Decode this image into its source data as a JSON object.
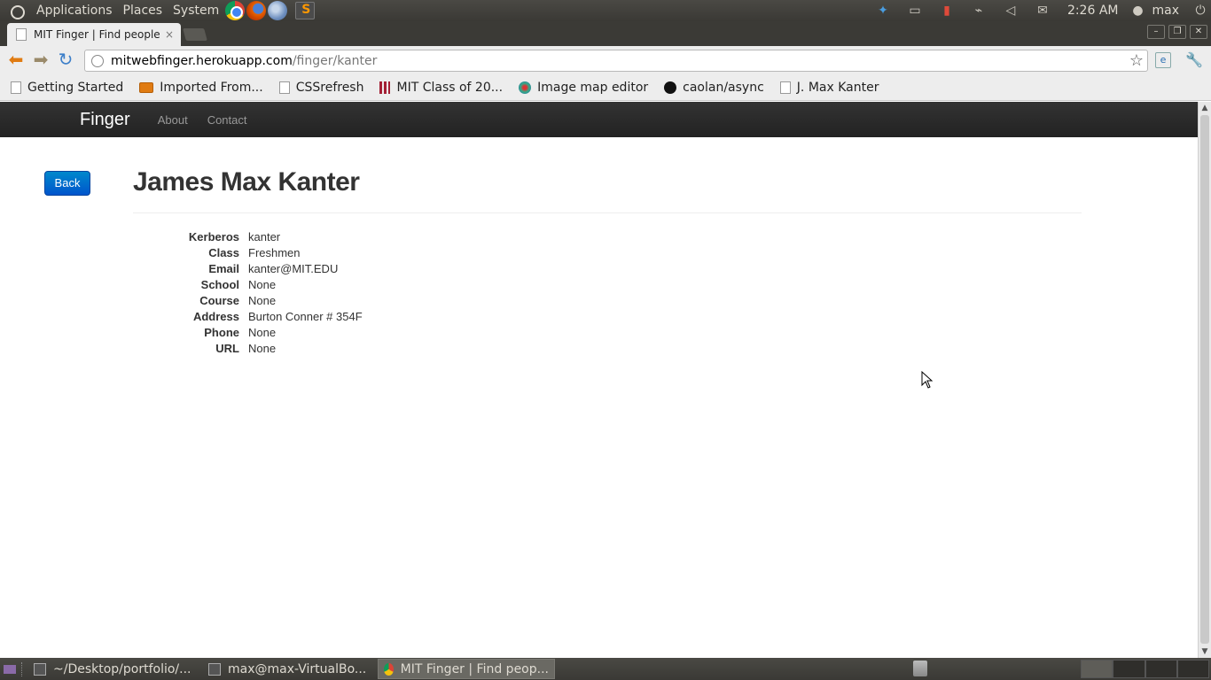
{
  "top_panel": {
    "menus": [
      "Applications",
      "Places",
      "System"
    ],
    "launchers": [
      "chrome-icon",
      "firefox-icon",
      "web-browser-icon",
      "sublime-text-icon"
    ],
    "tray_icons": [
      "dropbox-icon",
      "display-icon",
      "battery-icon",
      "network-icon",
      "volume-icon",
      "mail-icon"
    ],
    "clock": "2:26 AM",
    "user": "max"
  },
  "browser": {
    "tab": {
      "title": "MIT Finger | Find people al",
      "close": "×"
    },
    "url": {
      "host": "mitwebfinger.herokuapp.com",
      "path": "/finger/kanter"
    },
    "bookmarks": [
      {
        "label": "Getting Started",
        "icon": "page-icon"
      },
      {
        "label": "Imported From...",
        "icon": "folder-icon"
      },
      {
        "label": "CSSrefresh",
        "icon": "page-icon"
      },
      {
        "label": "MIT Class of 20...",
        "icon": "mit-icon"
      },
      {
        "label": "Image map editor",
        "icon": "map-icon"
      },
      {
        "label": "caolan/async",
        "icon": "github-icon"
      },
      {
        "label": "J. Max Kanter",
        "icon": "page-icon"
      }
    ]
  },
  "page": {
    "brand": "Finger",
    "nav": [
      "About",
      "Contact"
    ],
    "back_label": "Back",
    "title": "James Max Kanter",
    "details": [
      {
        "label": "Kerberos",
        "value": "kanter"
      },
      {
        "label": "Class",
        "value": "Freshmen"
      },
      {
        "label": "Email",
        "value": "kanter@MIT.EDU"
      },
      {
        "label": "School",
        "value": "None"
      },
      {
        "label": "Course",
        "value": "None"
      },
      {
        "label": "Address",
        "value": "Burton Conner # 354F"
      },
      {
        "label": "Phone",
        "value": "None"
      },
      {
        "label": "URL",
        "value": "None"
      }
    ]
  },
  "bottom_panel": {
    "tasks": [
      {
        "label": "~/Desktop/portfolio/...",
        "icon": "folder-icon",
        "active": false
      },
      {
        "label": "max@max-VirtualBo...",
        "icon": "terminal-icon",
        "active": false
      },
      {
        "label": "MIT Finger | Find peop...",
        "icon": "chrome-icon",
        "active": true
      }
    ]
  },
  "colors": {
    "accent": "#0088cc",
    "navbar": "#222222",
    "panel": "#3c3b37"
  }
}
